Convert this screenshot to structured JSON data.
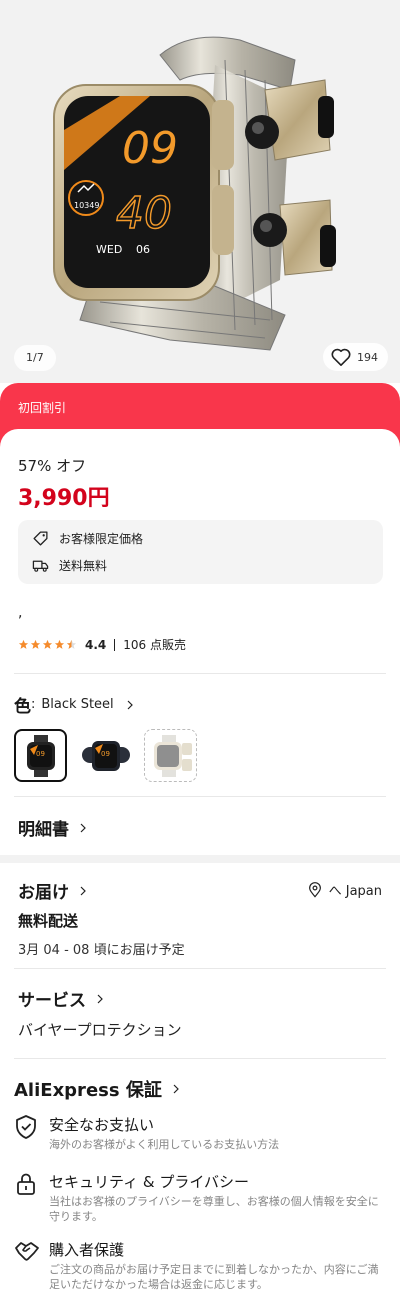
{
  "gallery": {
    "counter": "1/7",
    "wishlist_count": "194",
    "watch_display": {
      "hour": "09",
      "minute": "40",
      "steps": "10349",
      "weekday": "WED",
      "day": "06"
    }
  },
  "promo": {
    "label": "初回割引"
  },
  "pricing": {
    "discount": "57% オフ",
    "price": "3,990円"
  },
  "benefits": [
    {
      "icon": "tag-icon",
      "label": "お客様限定価格"
    },
    {
      "icon": "truck-icon",
      "label": "送料無料"
    }
  ],
  "title_text": ",",
  "rating": {
    "value": "4.4",
    "stars": 4.4,
    "max_stars": 5,
    "sold": "106 点販売"
  },
  "color": {
    "label": "色",
    "separator": ":",
    "value": "Black Steel",
    "options": [
      "Black Steel",
      "Black",
      "Silver"
    ],
    "selected_index": 0
  },
  "specs": {
    "label": "明細書"
  },
  "shipping": {
    "label": "お届け",
    "location": "へ Japan",
    "method": "無料配送",
    "date": "3月 04 - 08 頃にお届け予定"
  },
  "service": {
    "label": "サービス",
    "item": "バイヤープロテクション"
  },
  "guarantee": {
    "label": "AliExpress 保証",
    "items": [
      {
        "icon": "shield-check-icon",
        "title": "安全なお支払い",
        "desc": "海外のお客様がよく利用しているお支払い方法"
      },
      {
        "icon": "lock-icon",
        "title": "セキュリティ & プライバシー",
        "desc": "当社はお客様のプライバシーを尊重し、お客様の個人情報を安全に守ります。"
      },
      {
        "icon": "handshake-icon",
        "title": "購入者保護",
        "desc": "ご注文の商品がお届け予定日までに到着しなかったか、内容にご満足いただけなかった場合は返金に応じます。"
      }
    ]
  },
  "colors": {
    "accent_red": "#d3031c",
    "promo_bg": "#f9364b",
    "star": "#f58b2c"
  }
}
